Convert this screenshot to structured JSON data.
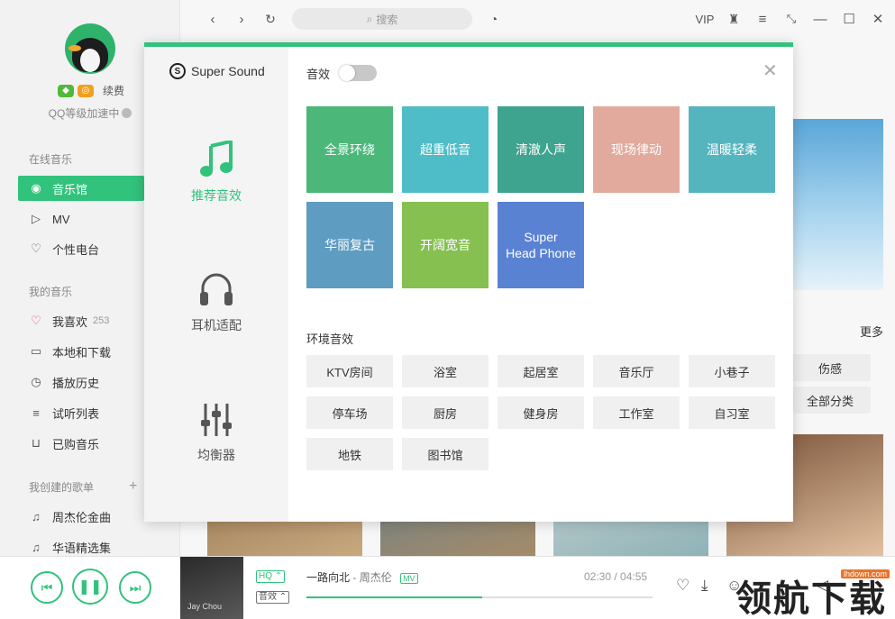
{
  "sidebar": {
    "renew": "续费",
    "qq_level": "QQ等级加速中",
    "sections": {
      "online": "在线音乐",
      "mine": "我的音乐",
      "created": "我创建的歌单"
    },
    "items": [
      {
        "label": "音乐馆",
        "icon": "music-hall-icon"
      },
      {
        "label": "MV",
        "icon": "mv-icon"
      },
      {
        "label": "个性电台",
        "icon": "radio-icon"
      },
      {
        "label": "我喜欢",
        "count": "253",
        "icon": "heart-icon"
      },
      {
        "label": "本地和下载",
        "icon": "monitor-icon"
      },
      {
        "label": "播放历史",
        "icon": "clock-icon"
      },
      {
        "label": "试听列表",
        "icon": "list-icon"
      },
      {
        "label": "已购音乐",
        "icon": "cart-icon"
      },
      {
        "label": "周杰伦金曲",
        "icon": "note-icon"
      },
      {
        "label": "华语精选集",
        "icon": "note-icon"
      }
    ]
  },
  "topbar": {
    "search_placeholder": "搜索",
    "vip": "VIP"
  },
  "background": {
    "more": "更多",
    "tags": [
      "伤感",
      "全部分类"
    ]
  },
  "modal": {
    "brand": "Super Sound",
    "tabs": [
      {
        "label": "推荐音效",
        "icon": "music-note-icon"
      },
      {
        "label": "耳机适配",
        "icon": "headphones-icon"
      },
      {
        "label": "均衡器",
        "icon": "equalizer-icon"
      }
    ],
    "effects_label": "音效",
    "effects_enabled": false,
    "presets": [
      {
        "label": "全景环绕",
        "color": "#4bb87a"
      },
      {
        "label": "超重低音",
        "color": "#4fbdc8"
      },
      {
        "label": "清澈人声",
        "color": "#3ea38f"
      },
      {
        "label": "现场律动",
        "color": "#e2aa9c"
      },
      {
        "label": "温暖轻柔",
        "color": "#55b5bf"
      },
      {
        "label": "华丽复古",
        "color": "#5e9cc2"
      },
      {
        "label": "开阔宽音",
        "color": "#86c050"
      },
      {
        "label": "Super\nHead Phone",
        "color": "#5a82d2"
      }
    ],
    "environment_title": "环境音效",
    "environment": [
      "KTV房间",
      "浴室",
      "起居室",
      "音乐厅",
      "小巷子",
      "停车场",
      "厨房",
      "健身房",
      "工作室",
      "自习室",
      "地铁",
      "图书馆"
    ]
  },
  "player": {
    "quality": "HQ",
    "effect": "音效",
    "song": "一路向北",
    "artist": "周杰伦",
    "mv": "MV",
    "time_current": "02:30",
    "time_total": "04:55",
    "progress": 0.508,
    "cover_text": "Jay Chou"
  },
  "watermark": {
    "site": "lhdown.com",
    "text": "领航下载"
  },
  "colors": {
    "accent": "#31c27c"
  }
}
